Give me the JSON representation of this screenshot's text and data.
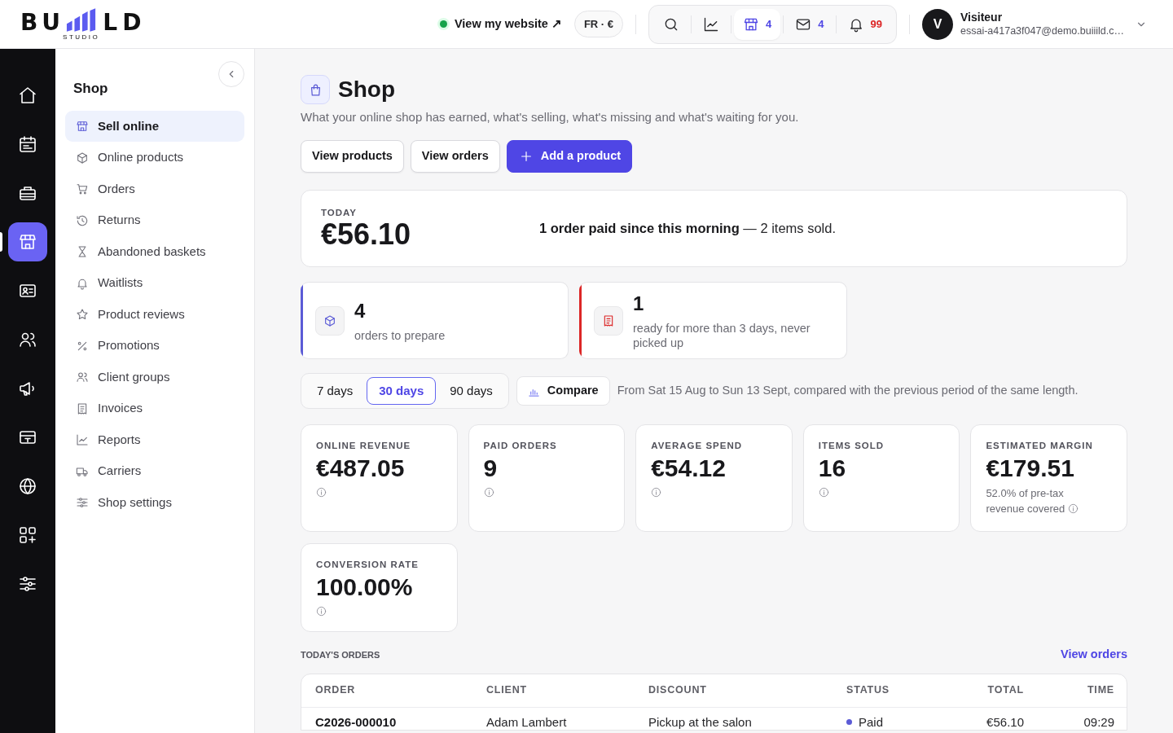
{
  "topbar": {
    "logo": {
      "left": "BU",
      "right": "LD",
      "tagline": "STUDIO"
    },
    "site_link": {
      "label": "View my website ↗",
      "online": true
    },
    "locale": "FR · €",
    "toolbar": [
      {
        "selected": false
      },
      {
        "selected": false
      },
      {
        "selected": true,
        "count": "4",
        "color": "#4f46e5"
      },
      {
        "selected": false,
        "count": "4",
        "color": "#4f46e5"
      },
      {
        "selected": false,
        "count": "99",
        "color": "#dc2626"
      }
    ],
    "user": {
      "initial": "V",
      "name": "Visiteur",
      "email": "essai-a417a3f047@demo.buiiild.c…"
    }
  },
  "rail": [
    {
      "selected": false
    },
    {
      "selected": false
    },
    {
      "selected": false
    },
    {
      "selected": true
    },
    {
      "selected": false
    },
    {
      "selected": false
    },
    {
      "selected": false
    },
    {
      "selected": false
    },
    {
      "selected": false
    },
    {
      "selected": false
    },
    {
      "selected": false
    }
  ],
  "sidebar": {
    "title": "Shop",
    "items": [
      {
        "label": "Sell online",
        "selected": true
      },
      {
        "label": "Online products",
        "selected": false
      },
      {
        "label": "Orders",
        "selected": false
      },
      {
        "label": "Returns",
        "selected": false
      },
      {
        "label": "Abandoned baskets",
        "selected": false
      },
      {
        "label": "Waitlists",
        "selected": false
      },
      {
        "label": "Product reviews",
        "selected": false
      },
      {
        "label": "Promotions",
        "selected": false
      },
      {
        "label": "Client groups",
        "selected": false
      },
      {
        "label": "Invoices",
        "selected": false
      },
      {
        "label": "Reports",
        "selected": false
      },
      {
        "label": "Carriers",
        "selected": false
      },
      {
        "label": "Shop settings",
        "selected": false
      }
    ]
  },
  "page": {
    "title": "Shop",
    "subtitle": "What your online shop has earned, what's selling, what's missing and what's waiting for you.",
    "actions": [
      {
        "label": "View products",
        "kind": "secondary"
      },
      {
        "label": "View orders",
        "kind": "secondary"
      },
      {
        "label": "Add a product",
        "kind": "primary"
      }
    ]
  },
  "today": {
    "label": "TODAY",
    "value": "€56.10",
    "summary": "**1 order paid since this morning** — 2 items sold."
  },
  "alerts": [
    {
      "value": "4",
      "text": "orders to prepare",
      "color": "#5b5bd6"
    },
    {
      "value": "1",
      "text": "ready for more than 3 days, never picked up",
      "color": "#dc2626"
    }
  ],
  "periods": {
    "options": [
      {
        "label": "7 days",
        "selected": false
      },
      {
        "label": "30 days",
        "selected": true
      },
      {
        "label": "90 days",
        "selected": false
      }
    ],
    "compare": "Compare",
    "description": "From Sat 15 Aug to Sun 13 Sept, compared with the previous period of the same length."
  },
  "kpis": [
    {
      "label": "ONLINE REVENUE",
      "value": "€487.05"
    },
    {
      "label": "PAID ORDERS",
      "value": "9"
    },
    {
      "label": "AVERAGE SPEND",
      "value": "€54.12"
    },
    {
      "label": "ITEMS SOLD",
      "value": "16"
    },
    {
      "label": "ESTIMATED MARGIN",
      "value": "€179.51",
      "note": "52.0% of pre-tax revenue covered"
    },
    {
      "label": "CONVERSION RATE",
      "value": "100.00%"
    }
  ],
  "orders": {
    "title": "TODAY'S ORDERS",
    "link": "View orders",
    "columns": [
      "ORDER",
      "CLIENT",
      "DISCOUNT",
      "STATUS",
      "TOTAL",
      "TIME"
    ],
    "rows": [
      {
        "order": "C2026-000010",
        "client": "Adam Lambert",
        "discount": "Pickup at the salon",
        "status": "Paid",
        "color": "#5b5bd6",
        "total": "€56.10",
        "time": "09:29"
      }
    ]
  }
}
